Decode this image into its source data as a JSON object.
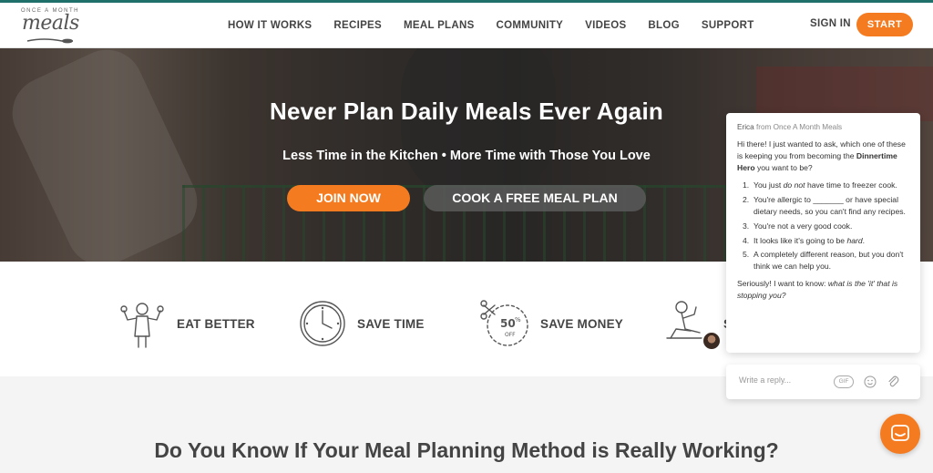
{
  "logo": {
    "small": "ONCE A MONTH",
    "big": "meals"
  },
  "nav": [
    {
      "label": "HOW IT WORKS"
    },
    {
      "label": "RECIPES"
    },
    {
      "label": "MEAL PLANS"
    },
    {
      "label": "COMMUNITY"
    },
    {
      "label": "VIDEOS"
    },
    {
      "label": "BLOG"
    },
    {
      "label": "SUPPORT"
    }
  ],
  "auth": {
    "signin": "SIGN IN",
    "start": "START"
  },
  "hero": {
    "title": "Never Plan Daily Meals Ever Again",
    "subtitle": "Less Time in the Kitchen • More Time with Those You Love",
    "join": "JOIN NOW",
    "cook": "COOK A FREE MEAL PLAN"
  },
  "features": [
    {
      "label": "EAT BETTER",
      "icon": "strong-man-icon"
    },
    {
      "label": "SAVE TIME",
      "icon": "clock-icon"
    },
    {
      "label": "SAVE MONEY",
      "icon": "coupon-icon"
    },
    {
      "label": "S",
      "icon": "relaxing-person-icon"
    }
  ],
  "bottom": {
    "title": "Do You Know If Your Meal Planning Method is Really Working?"
  },
  "chat": {
    "sender": "Erica",
    "from": "from Once A Month Meals",
    "intro_pre": "Hi there!  I just wanted to ask, which one of these is keeping you from becoming the ",
    "intro_bold": "Dinnertime Hero",
    "intro_post": " you want to be?",
    "items": [
      {
        "num": "1.",
        "pre": "You just ",
        "em": "do not",
        "post": " have time to freezer cook."
      },
      {
        "num": "2.",
        "pre": "You're allergic to _______ or have special dietary needs, so you can't find any recipes.",
        "em": "",
        "post": ""
      },
      {
        "num": "3.",
        "pre": "You're not a very good cook.",
        "em": "",
        "post": ""
      },
      {
        "num": "4.",
        "pre": "It looks like it's going to be ",
        "em": "hard",
        "post": "."
      },
      {
        "num": "5.",
        "pre": " A completely different reason, but you don't think we can help you.",
        "em": "",
        "post": ""
      }
    ],
    "closing_pre": "Seriously! I want to know: ",
    "closing_em": "what is the 'it' that is stopping you?",
    "reply_placeholder": "Write a reply...",
    "gif": "GIF"
  },
  "colors": {
    "accent": "#f47b20",
    "teal": "#1f6f6a"
  }
}
